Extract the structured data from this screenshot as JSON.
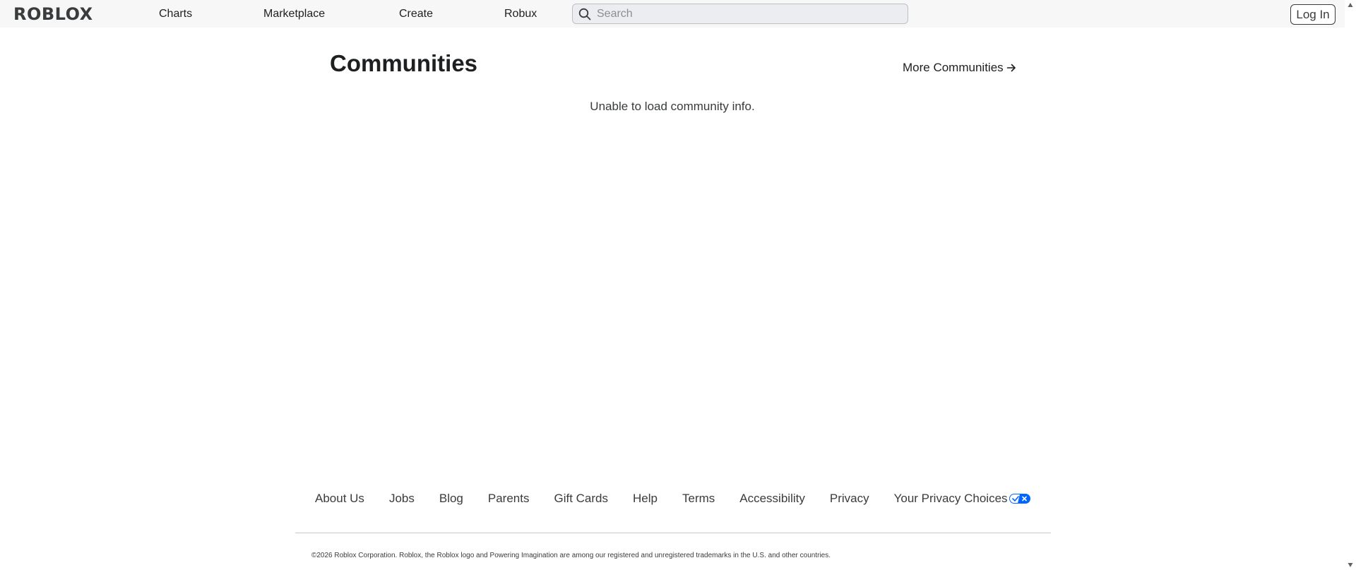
{
  "header": {
    "logo_text": "ROBLOX",
    "nav": [
      {
        "label": "Charts"
      },
      {
        "label": "Marketplace"
      },
      {
        "label": "Create"
      },
      {
        "label": "Robux"
      }
    ],
    "search": {
      "placeholder": "Search",
      "value": "",
      "icon": "search-icon"
    },
    "login_label": "Log In"
  },
  "main": {
    "title": "Communities",
    "more_link": {
      "label": "More Communities",
      "icon": "arrow-right-icon"
    },
    "status": "Unable to load community info."
  },
  "footer": {
    "links": [
      {
        "label": "About Us"
      },
      {
        "label": "Jobs"
      },
      {
        "label": "Blog"
      },
      {
        "label": "Parents"
      },
      {
        "label": "Gift Cards"
      },
      {
        "label": "Help"
      },
      {
        "label": "Terms"
      },
      {
        "label": "Accessibility"
      },
      {
        "label": "Privacy"
      },
      {
        "label": "Your Privacy Choices",
        "icon": "privacy-choices-icon"
      }
    ],
    "copyright": "©2026 Roblox Corporation. Roblox, the Roblox logo and Powering Imagination are among our registered and unregistered trademarks in the U.S. and other countries."
  },
  "colors": {
    "header_bg": "#f7f7f8",
    "text_primary": "#1e1f21",
    "text_secondary": "#393b3d",
    "privacy_badge_blue": "#0066ff"
  }
}
